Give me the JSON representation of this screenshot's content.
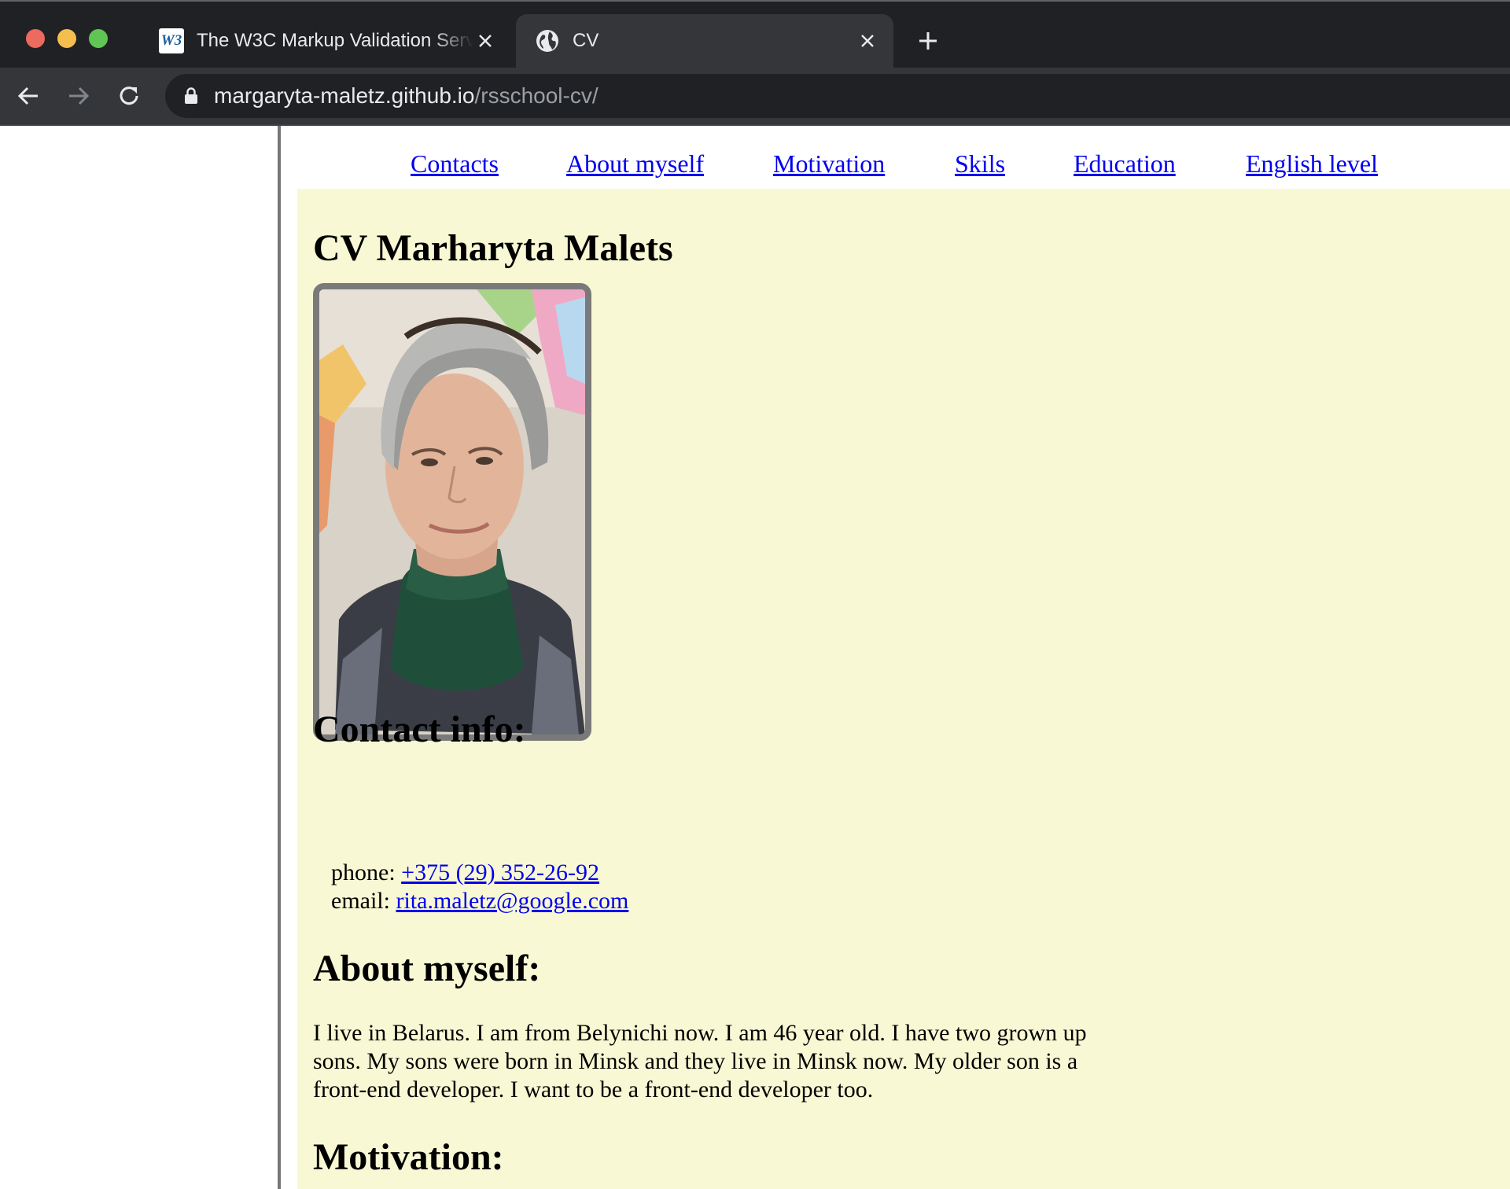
{
  "browser": {
    "tabs": [
      {
        "title": "The W3C Markup Validation Service",
        "favicon": "w3c-icon",
        "active": false
      },
      {
        "title": "CV",
        "favicon": "globe-icon",
        "active": true
      }
    ],
    "url": {
      "host": "margaryta-maletz.github.io",
      "path": "/rsschool-cv/"
    }
  },
  "nav": {
    "links": [
      "Contacts",
      "About myself",
      "Motivation",
      "Skils",
      "Education",
      "English level"
    ]
  },
  "main": {
    "title": "CV Marharyta Malets",
    "photo_alt": "Photo",
    "contact": {
      "heading": "Contact info:",
      "phone_label": "phone:",
      "phone": "+375 (29) 352-26-92",
      "email_label": "email:",
      "email": "rita.maletz@google.com"
    },
    "about": {
      "heading": "About myself:",
      "text": "I live in Belarus. I am from Belynichi now. I am 46 year old. I have two grown up sons. My sons were born in Minsk and they live in Minsk now. My older son is a front-end developer. I want to be a front-end developer too."
    },
    "motivation": {
      "heading": "Motivation:"
    }
  },
  "colors": {
    "page_bg": "#f8f8d4",
    "link": "#0000ee",
    "photo_border": "#7a7a7a"
  }
}
